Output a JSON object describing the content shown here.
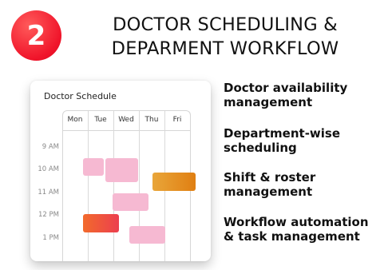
{
  "badge": {
    "number": "2",
    "color": "#f0142a"
  },
  "title": {
    "line1": "DOCTOR SCHEDULING &",
    "line2": "DEPARMENT WORKFLOW"
  },
  "schedule_card": {
    "title": "Doctor Schedule",
    "days": [
      "Mon",
      "Tue",
      "Wed",
      "Thu",
      "Fri"
    ],
    "times": [
      "9 AM",
      "10 AM",
      "11 AM",
      "12 PM",
      "1 PM"
    ],
    "events": [
      {
        "day": "Tue",
        "start": "10 AM",
        "end": "10:45 AM",
        "color": "#f6b9d2"
      },
      {
        "day": "Wed",
        "start": "10 AM",
        "end": "11 AM",
        "color": "#f6b9d2"
      },
      {
        "day": "Fri",
        "start": "10:30 AM",
        "end": "11 AM",
        "color": "#e6921c"
      },
      {
        "day": "Wed",
        "start": "11 AM",
        "end": "11:45 AM",
        "color": "#f6b9d2"
      },
      {
        "day": "Tue",
        "start": "12 PM",
        "end": "12:45 PM",
        "color": "#f26a2c"
      },
      {
        "day": "Thu",
        "start": "12:30 PM",
        "end": "1:15 PM",
        "color": "#f6b9d2"
      }
    ]
  },
  "features": [
    {
      "line1": "Doctor availability",
      "line2": "management"
    },
    {
      "line1": "Department-wise",
      "line2": "scheduling"
    },
    {
      "line1": "Shift & roster",
      "line2": "management"
    },
    {
      "line1": "Workflow automation",
      "line2": "& task management"
    }
  ]
}
